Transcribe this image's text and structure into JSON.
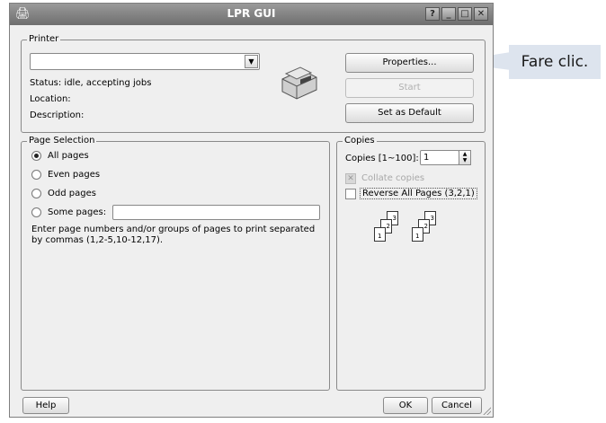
{
  "window": {
    "title": "LPR GUI",
    "help_btn": "?",
    "min_btn": "_",
    "max_btn": "□",
    "close_btn": "✕"
  },
  "printer": {
    "legend": "Printer",
    "selected": "",
    "status": "Status: idle, accepting jobs",
    "location": "Location:",
    "description": "Description:",
    "properties_label": "Properties...",
    "start_label": "Start",
    "default_label": "Set as Default"
  },
  "page_selection": {
    "legend": "Page Selection",
    "options": [
      "All pages",
      "Even pages",
      "Odd pages",
      "Some pages:"
    ],
    "selected": "All pages",
    "some_pages_value": "",
    "hint": "Enter page numbers and/or groups of pages to print separated by commas (1,2-5,10-12,17)."
  },
  "copies": {
    "legend": "Copies",
    "copies_label": "Copies [1~100]:",
    "copies_value": "1",
    "collate_label": "Collate copies",
    "reverse_label": "Reverse All Pages (3,2,1)",
    "page_nums": [
      "3",
      "2",
      "1"
    ]
  },
  "footer": {
    "help_label": "Help",
    "ok_label": "OK",
    "cancel_label": "Cancel"
  },
  "callout": {
    "text": "Fare clic."
  },
  "colors": {
    "titlebar": "#7f7f7f",
    "window_bg": "#efefef",
    "callout_bg": "#dde4ee"
  }
}
